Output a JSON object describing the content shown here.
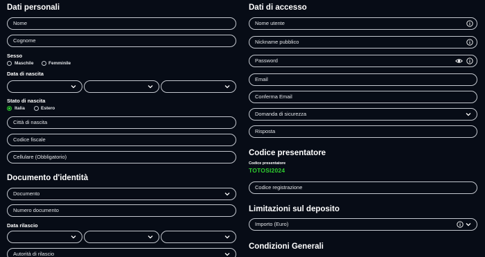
{
  "left": {
    "personal_title": "Dati personali",
    "nome": "Nome",
    "cognome": "Cognome",
    "sesso_label": "Sesso",
    "maschile": "Maschile",
    "femminile": "Femminile",
    "data_nascita_label": "Data di nascita",
    "stato_nascita_label": "Stato di nascita",
    "italia": "Italia",
    "estero": "Estero",
    "citta_nascita": "Città di nascita",
    "codice_fiscale": "Codice fiscale",
    "cellulare": "Cellulare (Obbligatorio)",
    "documento_title": "Documento d'identità",
    "documento": "Documento",
    "numero_documento": "Numero documento",
    "data_rilascio_label": "Data rilascio",
    "autorita_rilascio": "Autorità di rilascio"
  },
  "right": {
    "accesso_title": "Dati di accesso",
    "nome_utente": "Nome utente",
    "nickname": "Nickname pubblico",
    "password": "Password",
    "email": "Email",
    "conferma_email": "Conferma Email",
    "domanda_sicurezza": "Domanda di sicurezza",
    "risposta": "Risposta",
    "presentatore_title": "Codice presentatore",
    "presentatore_small": "Codice presentatore",
    "promo_code": "TOTOSI2024",
    "codice_registrazione": "Codice registrazione",
    "limitazioni_title": "Limitazioni sul deposito",
    "importo": "Importo (Euro)",
    "condizioni_title": "Condizioni Generali"
  },
  "icons": {
    "chevron": "chevron-down-icon",
    "info": "info-icon",
    "eye": "eye-icon"
  },
  "colors": {
    "background": "#070c16",
    "border": "#c4c8cf",
    "accent_green": "#2fd12f",
    "text": "#ffffff"
  }
}
